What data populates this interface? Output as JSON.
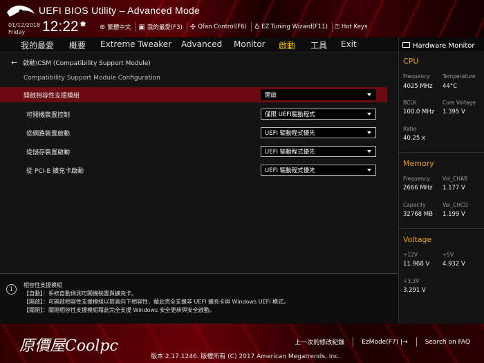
{
  "header": {
    "title": "UEFI BIOS Utility – Advanced Mode",
    "date": "01/12/2018",
    "day": "Friday",
    "time": "12:22",
    "tools": [
      {
        "icon": "globe-icon",
        "label": "繁體中文"
      },
      {
        "icon": "favorites-icon",
        "label": "我的最愛(F3)"
      },
      {
        "icon": "fan-icon",
        "label": "Qfan Control(F6)"
      },
      {
        "icon": "bulb-icon",
        "label": "EZ Tuning Wizard(F11)"
      },
      {
        "icon": "help-icon",
        "label": "Hot Keys"
      }
    ]
  },
  "nav": {
    "items": [
      "我的最愛",
      "概要",
      "Extreme Tweaker",
      "Advanced",
      "Monitor",
      "啟動",
      "工具",
      "Exit"
    ],
    "active": "啟動"
  },
  "main": {
    "breadcrumb": "啟動\\CSM (Compatibility Support Module)",
    "section_title": "Compatibility Support Module Configuration",
    "settings": [
      {
        "label": "開啟相容性支援模組",
        "value": "開啟"
      },
      {
        "label": "可開機裝置控制",
        "value": "僅限 UEFI驅動程式"
      },
      {
        "label": "從網路裝置啟動",
        "value": "UEFI 驅動程式優先"
      },
      {
        "label": "從儲存裝置啟動",
        "value": "UEFI 驅動程式優先"
      },
      {
        "label": "從 PCI-E 擴充卡啟動",
        "value": "UEFI 驅動程式優先"
      }
    ]
  },
  "help": {
    "lines": [
      "相容性支援模組",
      "【自動】：系統自動偵測可開機裝置與擴充卡。",
      "【開啟】：可開啟相容性支援模組以提高向下相容性，藉此完全支援非 UEFI 擴充卡與 Windows UEFI 模式。",
      "【關閉】：關閉相容性支援模組藉此完全支援 Windows 安全更新與安全啟動。"
    ]
  },
  "hw_monitor": {
    "title": "Hardware Monitor",
    "cpu": {
      "heading": "CPU",
      "frequency_label": "Frequency",
      "frequency": "4025 MHz",
      "temperature_label": "Temperature",
      "temperature": "44°C",
      "bclk_label": "BCLK",
      "bclk": "100.0 MHz",
      "core_voltage_label": "Core Voltage",
      "core_voltage": "1.395 V",
      "ratio_label": "Ratio",
      "ratio": "40.25 x"
    },
    "memory": {
      "heading": "Memory",
      "frequency_label": "Frequency",
      "frequency": "2666 MHz",
      "vol_chab_label": "Vol_CHAB",
      "vol_chab": "1.177 V",
      "capacity_label": "Capacity",
      "capacity": "32768 MB",
      "vol_chcd_label": "Vol_CHCD",
      "vol_chcd": "1.199 V"
    },
    "voltage": {
      "heading": "Voltage",
      "v12_label": "+12V",
      "v12": "11.968 V",
      "v5_label": "+5V",
      "v5": "4.932 V",
      "v33_label": "+3.3V",
      "v33": "3.291 V"
    }
  },
  "footer": {
    "watermark": "原價屋Coolpc",
    "last_modified": "上一次的修改紀錄",
    "ezmode": "EzMode(F7)",
    "search": "Search on FAQ",
    "copyright": "版本 2.17.1246. 版權所有 (C) 2017 American Megatrends, Inc."
  },
  "colors": {
    "accent": "#f6c400",
    "highlight_row": "#6b0a10",
    "section_heading": "#f0a020"
  }
}
